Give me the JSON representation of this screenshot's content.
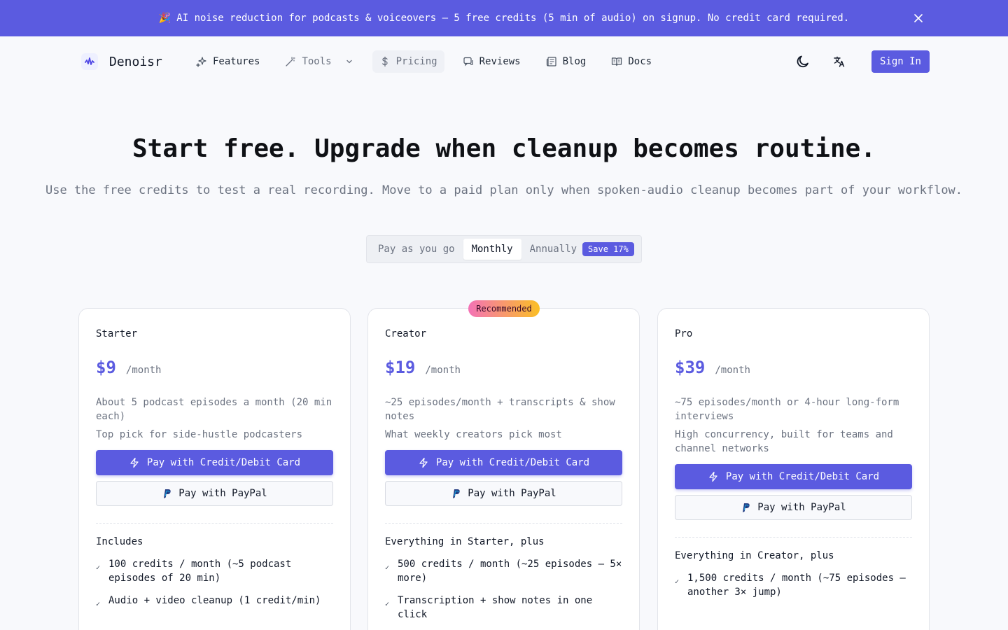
{
  "banner": {
    "emoji": "🎉",
    "text": "AI noise reduction for podcasts & voiceovers — 5 free credits (5 min of audio) on signup. No credit card required."
  },
  "nav": {
    "brand": "Denoisr",
    "links": [
      {
        "label": "Features",
        "icon": "sparkles-icon"
      },
      {
        "label": "Tools",
        "icon": "wand-icon"
      },
      {
        "label": "Pricing",
        "icon": "dollar-icon"
      },
      {
        "label": "Reviews",
        "icon": "message-icon"
      },
      {
        "label": "Blog",
        "icon": "newspaper-icon"
      },
      {
        "label": "Docs",
        "icon": "book-icon"
      }
    ],
    "sign_in": "Sign In"
  },
  "hero": {
    "title": "Start free. Upgrade when cleanup becomes routine.",
    "subtitle": "Use the free credits to test a real recording. Move to a paid plan only when spoken-audio cleanup becomes part of your workflow."
  },
  "billing": {
    "options": [
      "Pay as you go",
      "Monthly",
      "Annually"
    ],
    "selected": "Monthly",
    "save_badge": "Save 17%"
  },
  "recommended_badge": "Recommended",
  "plans": [
    {
      "name": "Starter",
      "price": "$9",
      "period": "/month",
      "description": "About 5 podcast episodes a month (20 min each)",
      "tagline": "Top pick for side-hustle podcasters",
      "card_button": "Pay with Credit/Debit Card",
      "paypal_button": "Pay with PayPal",
      "includes_title": "Includes",
      "features": [
        "100 credits / month (~5 podcast episodes of 20 min)",
        "Audio + video cleanup (1 credit/min)"
      ]
    },
    {
      "name": "Creator",
      "price": "$19",
      "period": "/month",
      "description": "~25 episodes/month + transcripts & show notes",
      "tagline": "What weekly creators pick most",
      "card_button": "Pay with Credit/Debit Card",
      "paypal_button": "Pay with PayPal",
      "includes_title": "Everything in Starter, plus",
      "features": [
        "500 credits / month (~25 episodes — 5× more)",
        "Transcription + show notes in one click"
      ]
    },
    {
      "name": "Pro",
      "price": "$39",
      "period": "/month",
      "description": "~75 episodes/month or 4-hour long-form interviews",
      "tagline": "High concurrency, built for teams and channel networks",
      "card_button": "Pay with Credit/Debit Card",
      "paypal_button": "Pay with PayPal",
      "includes_title": "Everything in Creator, plus",
      "features": [
        "1,500 credits / month (~75 episodes — another 3× jump)"
      ]
    }
  ]
}
